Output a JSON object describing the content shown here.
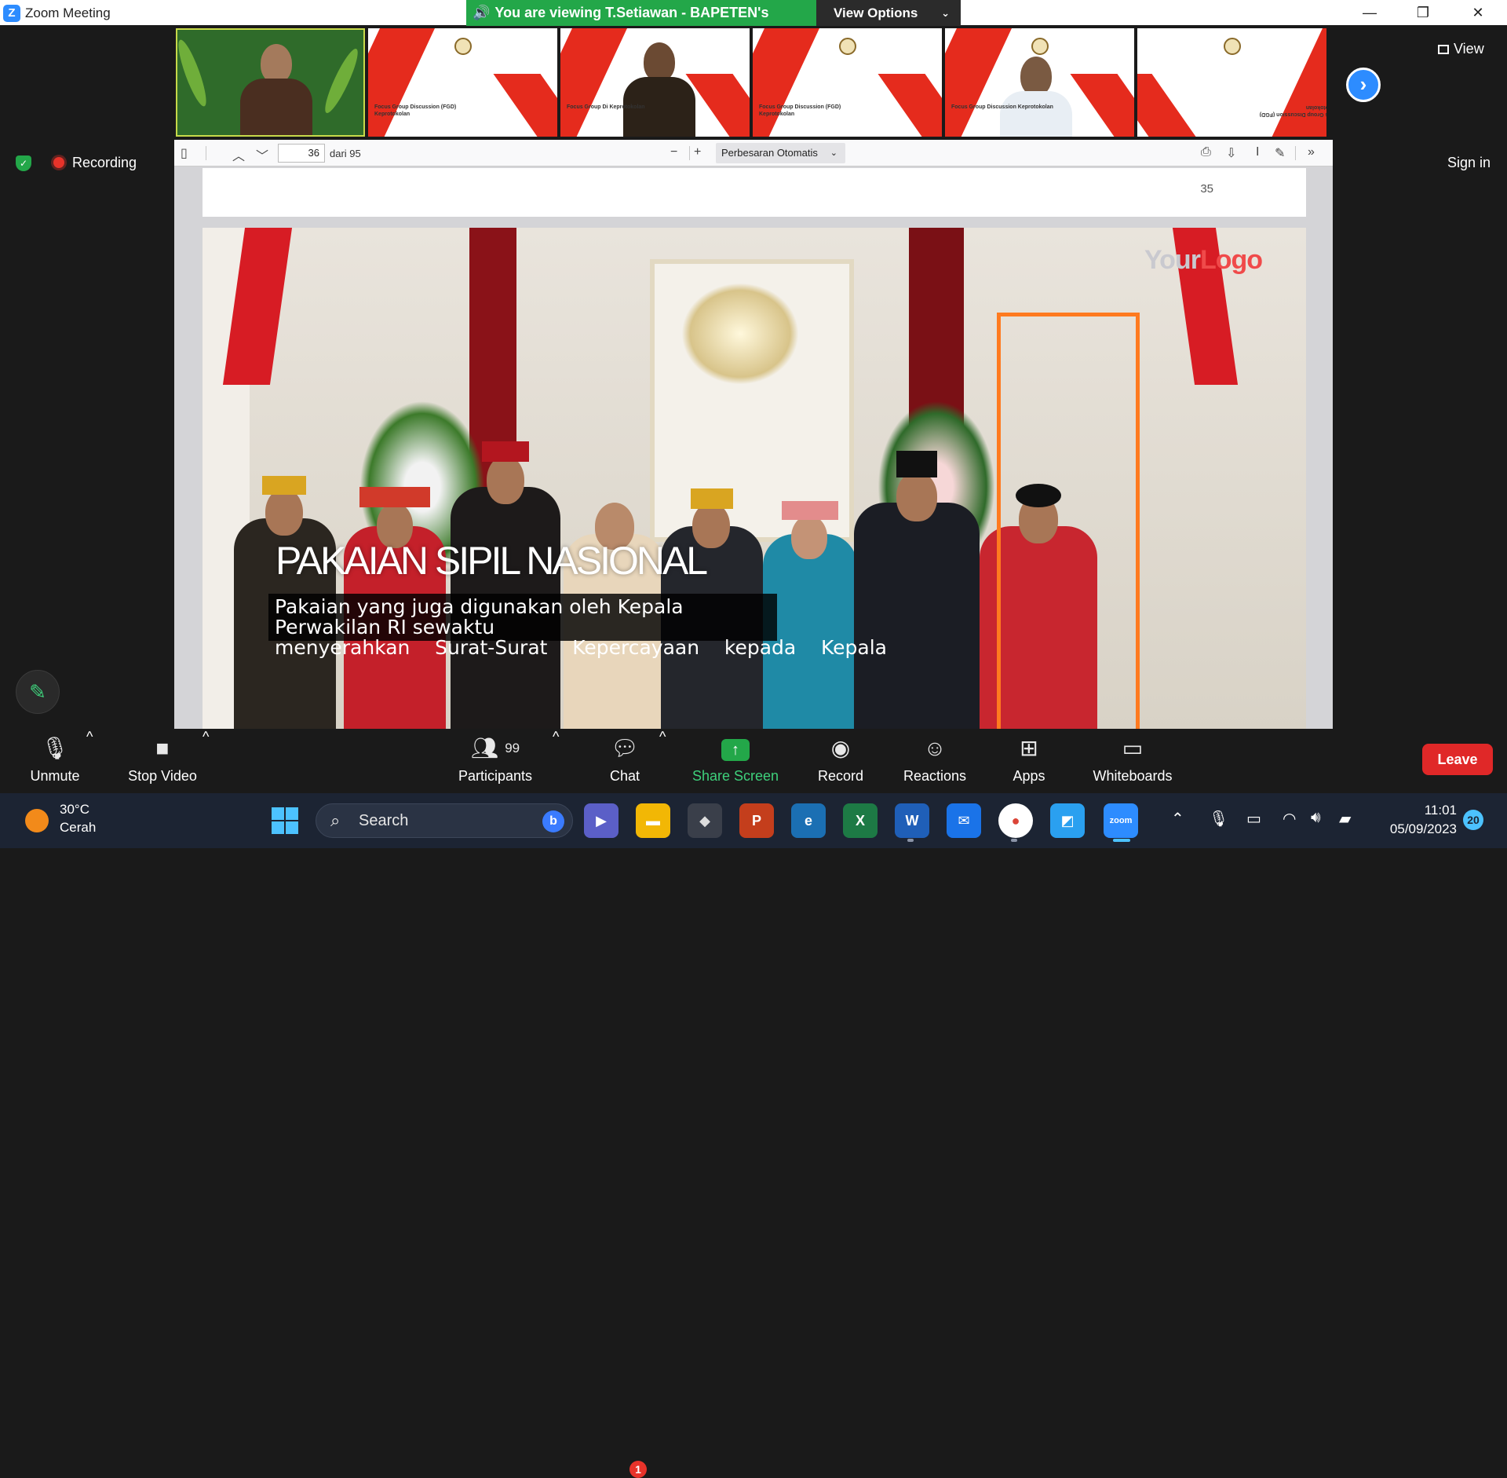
{
  "window": {
    "app_icon": "Z",
    "title": "Zoom Meeting",
    "controls": {
      "minimize": "—",
      "restore": "❐",
      "close": "✕"
    }
  },
  "banner": {
    "viewing_text": "You are viewing T.Setiawan - BAPETEN's screen",
    "view_options_label": "View Options",
    "speaker_icon": "speaker-icon"
  },
  "meeting": {
    "recording_label": "Recording",
    "view_label": "View",
    "signin_label": "Sign in",
    "next_arrow": "›"
  },
  "pdf_viewer": {
    "current_page": "36",
    "of_pages": "dari 95",
    "zoom_label": "Perbesaran Otomatis",
    "page_number_display": "35"
  },
  "slide": {
    "logo_part1": "Your",
    "logo_part2": "Logo",
    "title": "PAKAIAN SIPIL NASIONAL",
    "caption_line1": "Pakaian yang juga digunakan oleh Kepala Perwakilan RI sewaktu",
    "caption_line2": "menyerahkan    Surat-Surat    Kepercayaan    kepada    Kepala"
  },
  "controls": {
    "unmute": "Unmute",
    "stop_video": "Stop Video",
    "participants": "Participants",
    "participants_count": "99",
    "chat": "Chat",
    "chat_badge": "1",
    "share_screen": "Share Screen",
    "record": "Record",
    "reactions": "Reactions",
    "apps": "Apps",
    "whiteboards": "Whiteboards",
    "leave": "Leave"
  },
  "taskbar": {
    "temperature": "30°C",
    "condition": "Cerah",
    "search_placeholder": "Search",
    "time": "11:01",
    "date": "05/09/2023",
    "notifications": "20"
  },
  "thumbnails": [
    {
      "caption": ""
    },
    {
      "caption": "Focus Group Discussion (FGD) Keprotokolan"
    },
    {
      "caption": "Focus Group Di Keprotokolan"
    },
    {
      "caption": "Focus Group Discussion (FGD) Keprotokolan"
    },
    {
      "caption": "Focus Group Discussion Keprotokolan"
    },
    {
      "caption": "Focus Group Discussion (FGD) Keprotokolan"
    }
  ],
  "colors": {
    "zoom_blue": "#2d8cff",
    "banner_green": "#23a749",
    "leave_red": "#e02828",
    "highlight_orange": "#ff7a1f"
  }
}
